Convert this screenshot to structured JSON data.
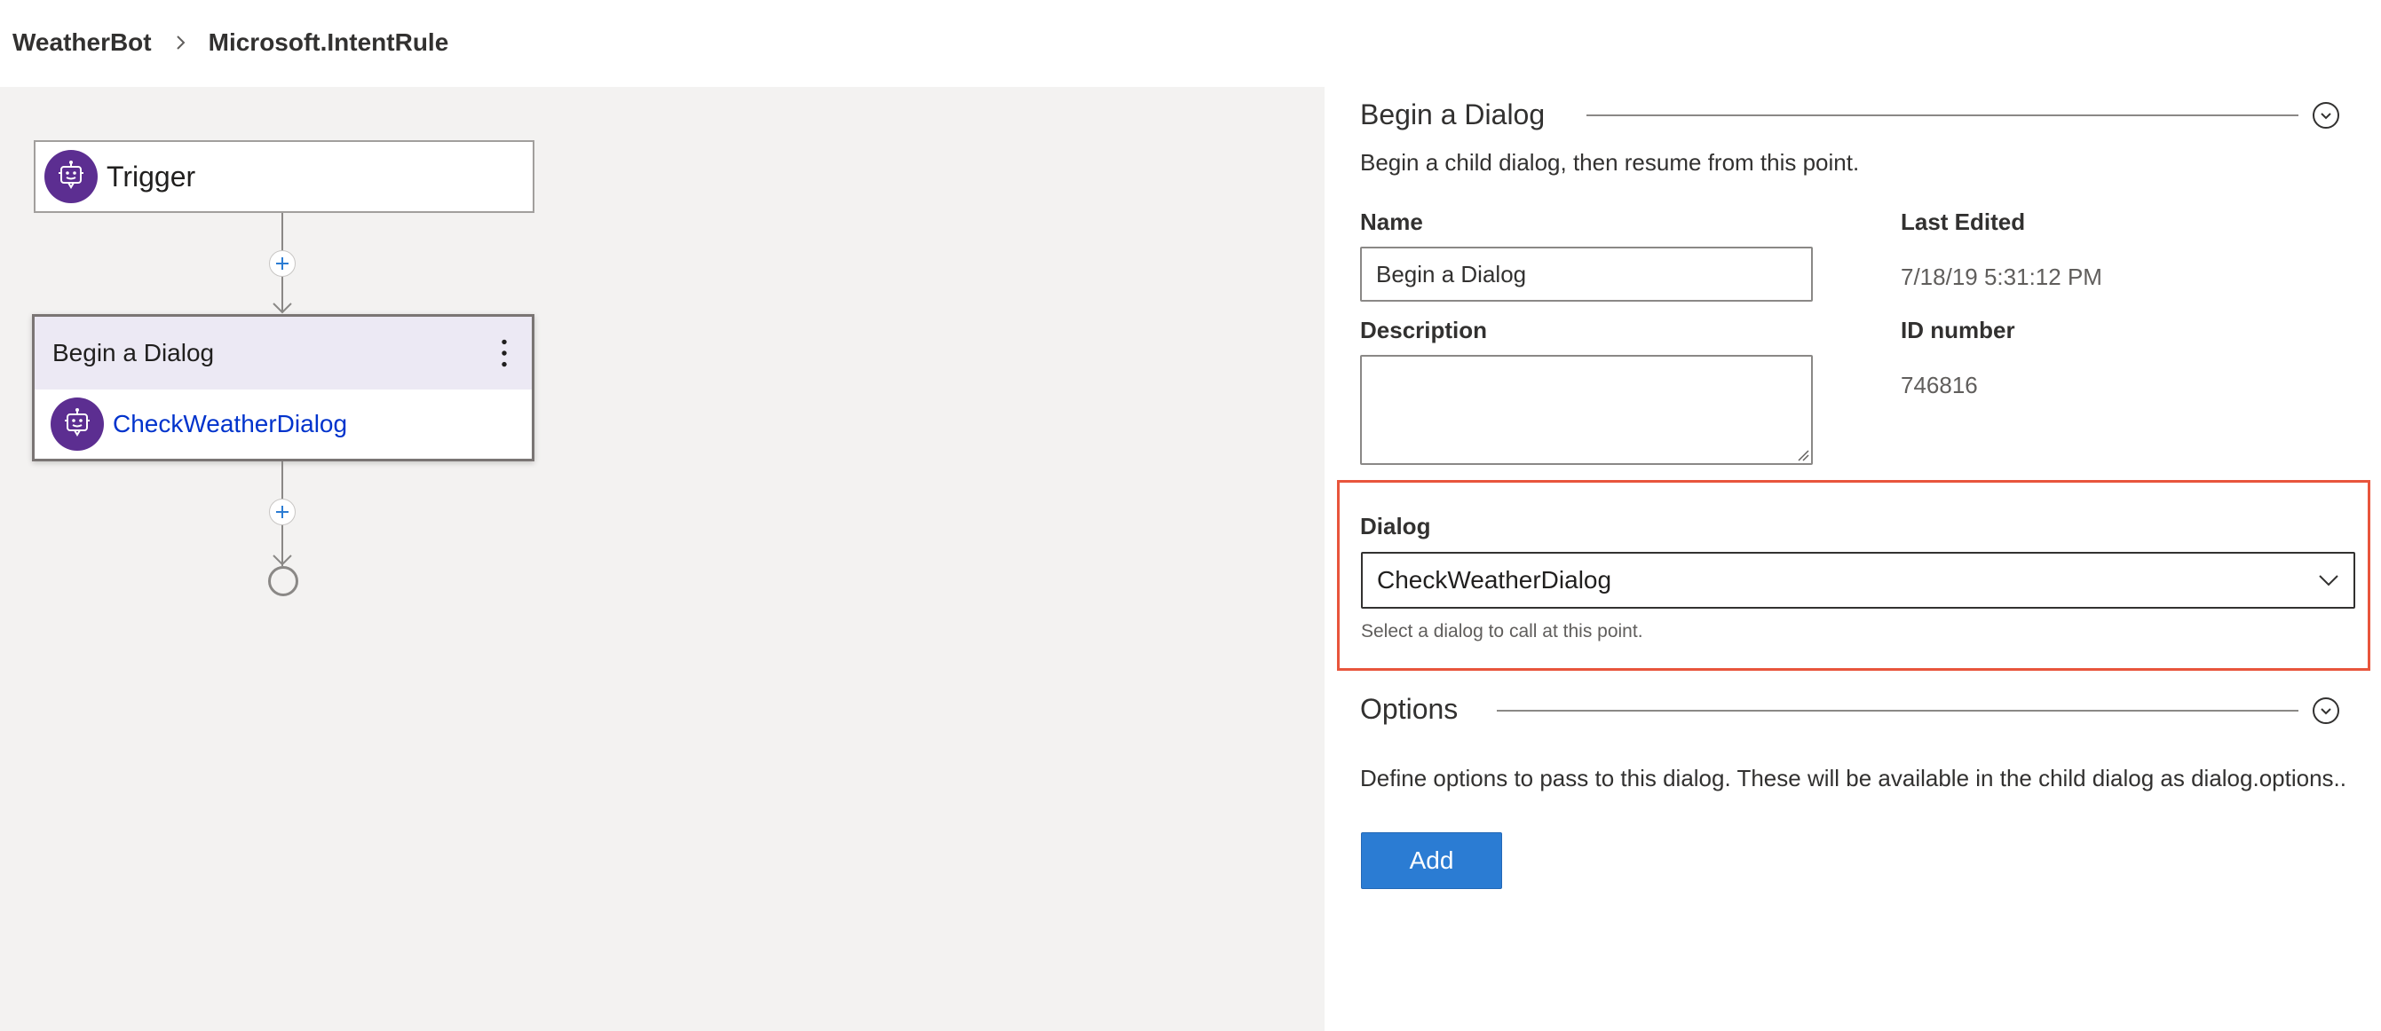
{
  "breadcrumb": {
    "items": [
      "WeatherBot",
      "Microsoft.IntentRule"
    ]
  },
  "canvas": {
    "trigger_node": {
      "label": "Trigger",
      "icon": "bot-icon"
    },
    "dialog_node": {
      "title": "Begin a Dialog",
      "link": "CheckWeatherDialog",
      "icon": "bot-icon",
      "menu_icon": "more-vertical-icon"
    }
  },
  "panel": {
    "section_title": "Begin a Dialog",
    "section_description": "Begin a child dialog, then resume from this point.",
    "name_label": "Name",
    "name_value": "Begin a Dialog",
    "description_label": "Description",
    "description_value": "",
    "last_edited_label": "Last Edited",
    "last_edited_value": "7/18/19 5:31:12 PM",
    "id_label": "ID number",
    "id_value": "746816",
    "dialog_label": "Dialog",
    "dialog_selected": "CheckWeatherDialog",
    "dialog_helper": "Select a dialog to call at this point.",
    "options_title": "Options",
    "options_description": "Define options to pass to this dialog. These will be available in the child dialog as dialog.options..",
    "add_button": "Add"
  },
  "colors": {
    "bot_purple": "#5c2e91",
    "accent_blue": "#2b7cd3",
    "link_blue": "#0033cc",
    "highlight_red": "#e8553c",
    "canvas_bg": "#f3f2f1",
    "node_header_bg": "#ece9f4"
  }
}
